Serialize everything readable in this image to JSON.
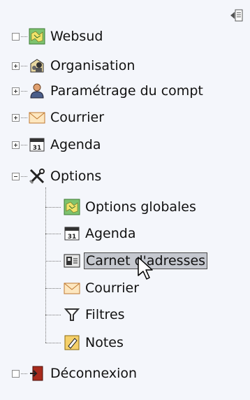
{
  "tree": {
    "items": [
      {
        "label": "Websud",
        "expander": "empty",
        "icon": "map-icon"
      },
      {
        "label": "Organisation",
        "expander": "plus",
        "icon": "org-icon"
      },
      {
        "label": "Paramétrage du compt",
        "expander": "plus",
        "icon": "user-icon"
      },
      {
        "label": "Courrier",
        "expander": "plus",
        "icon": "envelope-icon"
      },
      {
        "label": "Agenda",
        "expander": "plus",
        "icon": "calendar-icon"
      },
      {
        "label": "Options",
        "expander": "minus",
        "icon": "tools-icon"
      }
    ],
    "options_children": [
      {
        "label": "Options globales",
        "icon": "map-icon"
      },
      {
        "label": "Agenda",
        "icon": "calendar-icon"
      },
      {
        "label": "Carnet d'adresses",
        "icon": "address-book-icon",
        "selected": true
      },
      {
        "label": "Courrier",
        "icon": "envelope-icon"
      },
      {
        "label": "Filtres",
        "icon": "filter-icon"
      },
      {
        "label": "Notes",
        "icon": "notes-icon"
      }
    ],
    "logout": {
      "label": "Déconnexion",
      "expander": "empty",
      "icon": "logout-icon"
    }
  },
  "calendar_icon_text": "31"
}
